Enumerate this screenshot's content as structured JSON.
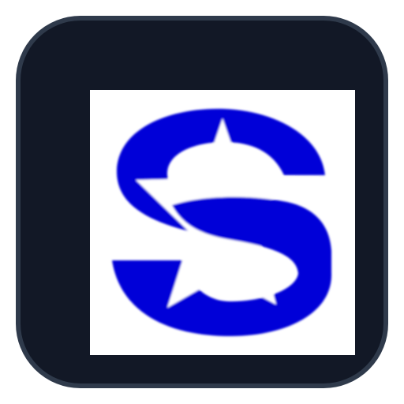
{
  "app_icon": {
    "icon": "star-s-logo-icon",
    "colors": {
      "tile_background": "#121826",
      "tile_border": "#2f3a4b",
      "logo_background": "#ffffff",
      "logo_primary": "#0000d8",
      "logo_star": "#ffffff"
    }
  }
}
